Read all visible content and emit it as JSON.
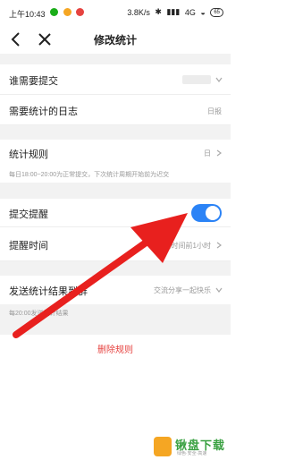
{
  "status_bar": {
    "time": "上午10:43",
    "network_speed": "3.8K/s",
    "signal": "4G",
    "battery": "65"
  },
  "nav": {
    "title": "修改统计"
  },
  "rows": {
    "submitters": {
      "label": "谁需要提交",
      "value": ""
    },
    "log_type": {
      "label": "需要统计的日志",
      "value": "日报"
    },
    "rules": {
      "label": "统计规则",
      "value": "日"
    },
    "rules_note": "每日18:00~20:00为正常提交，下次统计周期开始前为迟交",
    "reminder": {
      "label": "提交提醒",
      "enabled": true
    },
    "reminder_time": {
      "label": "提醒时间",
      "value": "结束时间前1小时"
    },
    "send_to": {
      "label": "发送统计结果到群",
      "value": "交流分享一起快乐"
    },
    "send_note": "每20:00发送统计结果"
  },
  "delete_label": "删除规则",
  "watermark": {
    "brand": "锹盘下载",
    "slogan": "绿色·安全·高速"
  },
  "colors": {
    "accent_blue": "#2b83f6",
    "danger_red": "#e64340",
    "annotation_arrow": "#e8201e"
  }
}
